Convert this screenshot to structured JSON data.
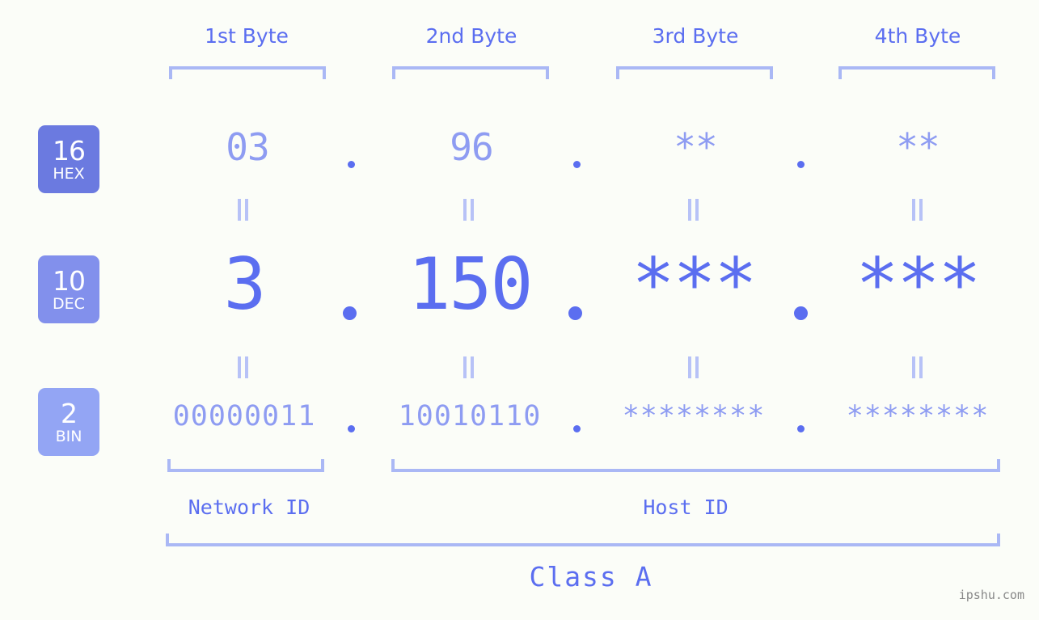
{
  "background_color": "#fbfdf8",
  "accent_color": "#5b6ef0",
  "accent_light_color": "#8e9cf2",
  "bracket_color": "#aab8f5",
  "byte_headers": [
    {
      "label": "1st Byte"
    },
    {
      "label": "2nd Byte"
    },
    {
      "label": "3rd Byte"
    },
    {
      "label": "4th Byte"
    }
  ],
  "rows": {
    "hex": {
      "badge_number": "16",
      "badge_name": "HEX",
      "badge_color": "#6b7ae0",
      "values": [
        "03",
        "96",
        "**",
        "**"
      ],
      "separator": "."
    },
    "dec": {
      "badge_number": "10",
      "badge_name": "DEC",
      "badge_color": "#8290ec",
      "values": [
        "3",
        "150",
        "***",
        "***"
      ],
      "separator": "."
    },
    "bin": {
      "badge_number": "2",
      "badge_name": "BIN",
      "badge_color": "#93a5f4",
      "values": [
        "00000011",
        "10010110",
        "********",
        "********"
      ],
      "separator": "."
    }
  },
  "equals_symbol": "||",
  "sections": {
    "network_id": "Network ID",
    "host_id": "Host ID",
    "class": "Class A"
  },
  "watermark": "ipshu.com"
}
